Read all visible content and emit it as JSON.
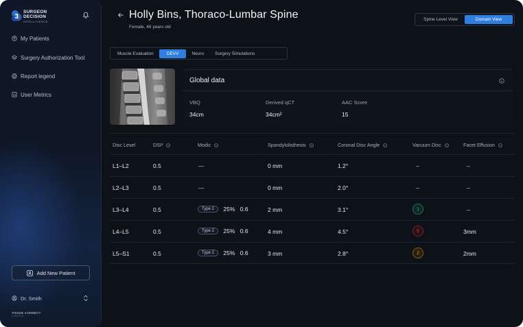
{
  "brand": {
    "line1": "SURGEON",
    "line2": "DECISION",
    "line3": "INTELLIGENCE"
  },
  "sidebar": {
    "items": [
      {
        "label": "My Patients",
        "icon": "patients-icon"
      },
      {
        "label": "Surgery Authorization Tool",
        "icon": "layers-icon"
      },
      {
        "label": "Report legend",
        "icon": "globe-icon"
      },
      {
        "label": "User Metrics",
        "icon": "chart-icon"
      }
    ],
    "add_patient_label": "Add New Patient",
    "user_name": "Dr. Smith",
    "footer_logo": "TISSUE CONNECT",
    "footer_sub": "SURGICAL"
  },
  "header": {
    "title": "Holly Bins, Thoraco-Lumbar Spine",
    "subtitle": "Female, 46 years old",
    "views": [
      "Spine Level View",
      "Domain View"
    ],
    "active_view": "Domain View"
  },
  "tabs": [
    "Muscle Evaluation",
    "DEVV",
    "Neuro",
    "Surgery Simulations"
  ],
  "active_tab": "DEVV",
  "global": {
    "title": "Global data",
    "metrics": [
      {
        "label": "VBQ",
        "value": "34cm"
      },
      {
        "label": "Derived qCT",
        "value": "34cm²"
      },
      {
        "label": "AAC Score",
        "value": "15"
      }
    ]
  },
  "table": {
    "columns": [
      "Disc Level",
      "DSI²",
      "Modic",
      "Spondylolisthesis",
      "Coronal Disc Angle",
      "Vacuum Disc",
      "Facet Effusion"
    ],
    "rows": [
      {
        "level": "L1–L2",
        "dsi": "0.5",
        "modic_type": "",
        "modic_pct": "",
        "modic_val": "",
        "modic_dash": "—",
        "spondy": "0 mm",
        "angle": "1.2°",
        "vacuum": "",
        "vacuum_dash": "–",
        "facet": "–"
      },
      {
        "level": "L2–L3",
        "dsi": "0.5",
        "modic_type": "",
        "modic_pct": "",
        "modic_val": "",
        "modic_dash": "—",
        "spondy": "0 mm",
        "angle": "2.0°",
        "vacuum": "",
        "vacuum_dash": "–",
        "facet": "–"
      },
      {
        "level": "L3–L4",
        "dsi": "0.5",
        "modic_type": "Type 2",
        "modic_pct": "25%",
        "modic_val": "0.6",
        "modic_dash": "",
        "spondy": "2 mm",
        "angle": "3.1°",
        "vacuum": "1",
        "vacuum_dash": "",
        "facet": "–"
      },
      {
        "level": "L4–L5",
        "dsi": "0.5",
        "modic_type": "Type 2",
        "modic_pct": "25%",
        "modic_val": "0.6",
        "modic_dash": "",
        "spondy": "4 mm",
        "angle": "4.5°",
        "vacuum": "5",
        "vacuum_dash": "",
        "facet": "3mm"
      },
      {
        "level": "L5–S1",
        "dsi": "0.5",
        "modic_type": "Type 2",
        "modic_pct": "25%",
        "modic_val": "0.6",
        "modic_dash": "",
        "spondy": "3 mm",
        "angle": "2.8°",
        "vacuum": "2",
        "vacuum_dash": "",
        "facet": "2mm"
      }
    ]
  },
  "colors": {
    "accent": "#2f7fe0",
    "vacuum_1": "#2fb58a",
    "vacuum_5": "#e0405a",
    "vacuum_2": "#e0a030"
  }
}
